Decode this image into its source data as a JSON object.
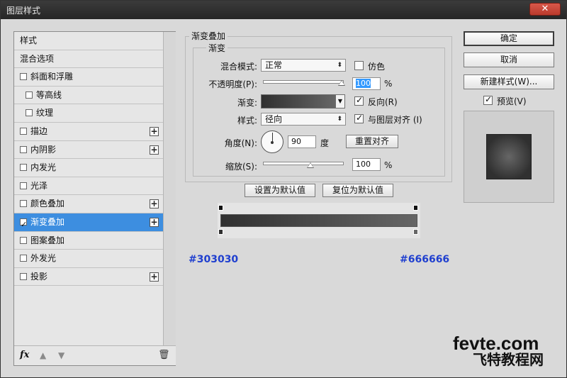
{
  "window": {
    "title": "图层样式",
    "close_label": "✕"
  },
  "sidebar": {
    "items": [
      {
        "label": "样式",
        "checkbox": false,
        "checked": false,
        "plus": false,
        "sub": false,
        "active": false
      },
      {
        "label": "混合选项",
        "checkbox": false,
        "checked": false,
        "plus": false,
        "sub": false,
        "active": false
      },
      {
        "label": "斜面和浮雕",
        "checkbox": true,
        "checked": false,
        "plus": false,
        "sub": false,
        "active": false
      },
      {
        "label": "等高线",
        "checkbox": true,
        "checked": false,
        "plus": false,
        "sub": true,
        "active": false
      },
      {
        "label": "纹理",
        "checkbox": true,
        "checked": false,
        "plus": false,
        "sub": true,
        "active": false
      },
      {
        "label": "描边",
        "checkbox": true,
        "checked": false,
        "plus": true,
        "sub": false,
        "active": false
      },
      {
        "label": "内阴影",
        "checkbox": true,
        "checked": false,
        "plus": true,
        "sub": false,
        "active": false
      },
      {
        "label": "内发光",
        "checkbox": true,
        "checked": false,
        "plus": false,
        "sub": false,
        "active": false
      },
      {
        "label": "光泽",
        "checkbox": true,
        "checked": false,
        "plus": false,
        "sub": false,
        "active": false
      },
      {
        "label": "颜色叠加",
        "checkbox": true,
        "checked": false,
        "plus": true,
        "sub": false,
        "active": false
      },
      {
        "label": "渐变叠加",
        "checkbox": true,
        "checked": true,
        "plus": true,
        "sub": false,
        "active": true
      },
      {
        "label": "图案叠加",
        "checkbox": true,
        "checked": false,
        "plus": false,
        "sub": false,
        "active": false
      },
      {
        "label": "外发光",
        "checkbox": true,
        "checked": false,
        "plus": false,
        "sub": false,
        "active": false
      },
      {
        "label": "投影",
        "checkbox": true,
        "checked": false,
        "plus": true,
        "sub": false,
        "active": false
      }
    ],
    "footer": {
      "fx": "fx",
      "up": "▲",
      "down": "▼",
      "trash": "🗑"
    }
  },
  "panel": {
    "outer_legend": "渐变叠加",
    "inner_legend": "渐变",
    "blend_mode_label": "混合模式:",
    "blend_mode_value": "正常",
    "dither_label": "仿色",
    "dither_checked": false,
    "opacity_label": "不透明度(P):",
    "opacity_value": "100",
    "opacity_unit": "%",
    "gradient_label": "渐变:",
    "reverse_label": "反向(R)",
    "reverse_checked": true,
    "style_label": "样式:",
    "style_value": "径向",
    "align_label": "与图层对齐 (I)",
    "align_checked": true,
    "angle_label": "角度(N):",
    "angle_value": "90",
    "angle_unit": "度",
    "reset_align_label": "重置对齐",
    "scale_label": "缩放(S):",
    "scale_value": "100",
    "scale_unit": "%",
    "set_default_label": "设置为默认值",
    "reset_default_label": "复位为默认值"
  },
  "gradient": {
    "start_color": "#303030",
    "end_color": "#666666"
  },
  "annotations": {
    "left_hex": "#303030",
    "right_hex": "#666666"
  },
  "buttons": {
    "ok": "确定",
    "cancel": "取消",
    "new_style": "新建样式(W)...",
    "preview_label": "预览(V)",
    "preview_checked": true
  },
  "watermark": {
    "top": "fevte.com",
    "bottom": "飞特教程网"
  }
}
